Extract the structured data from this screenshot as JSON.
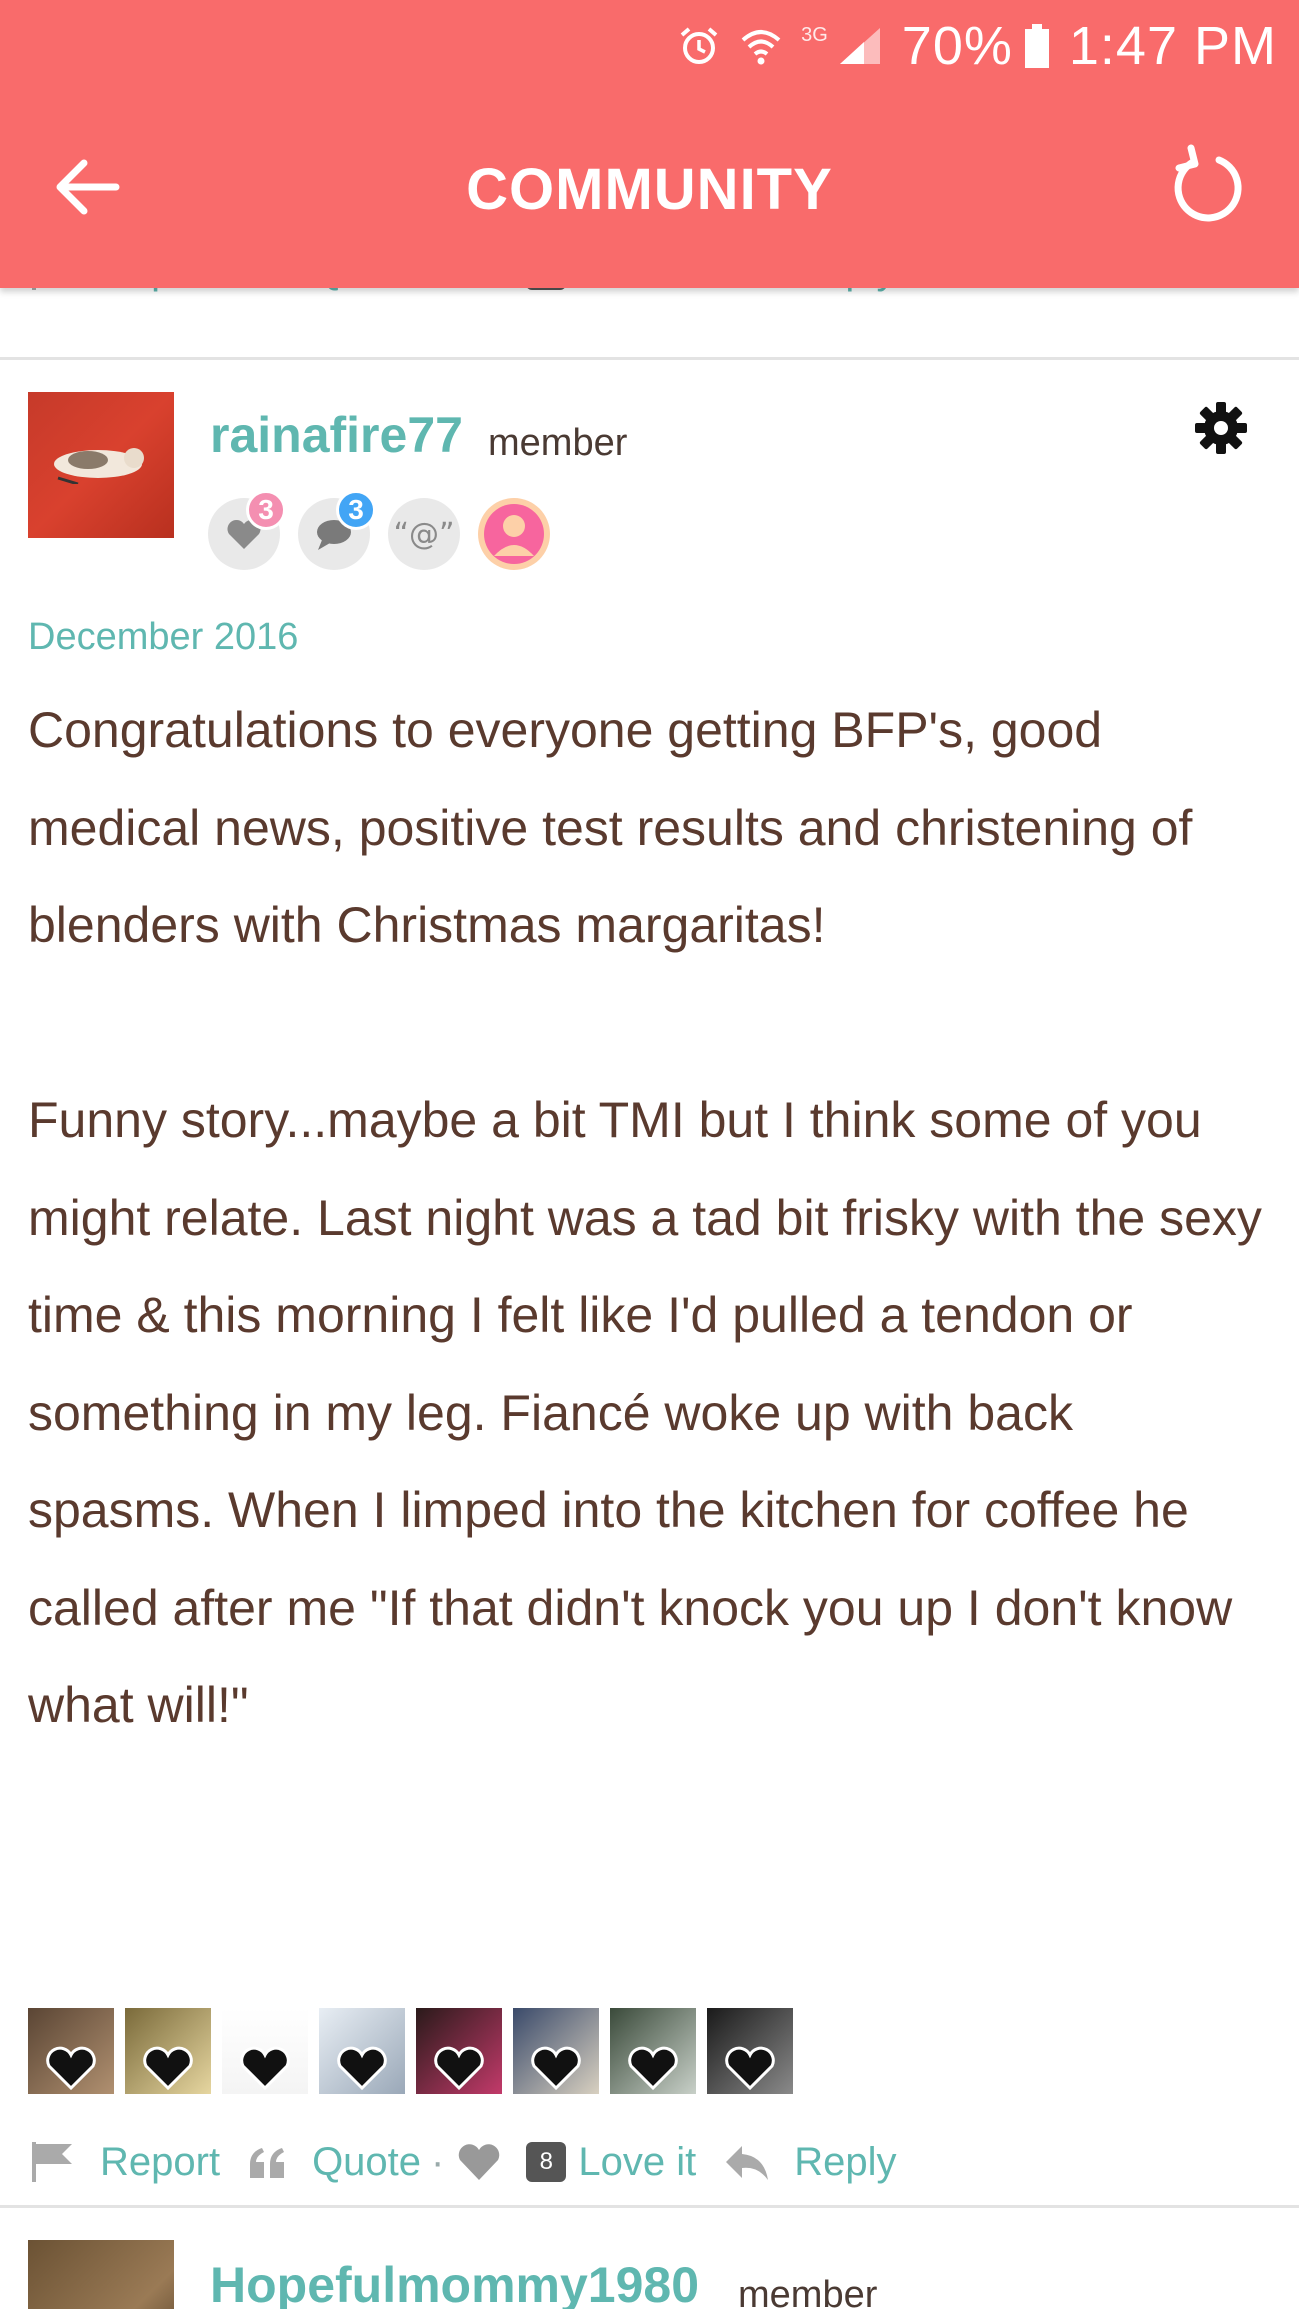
{
  "status_bar": {
    "network": "3G",
    "battery": "70%",
    "time": "1:47 PM"
  },
  "header": {
    "title": "COMMUNITY"
  },
  "actions": {
    "report": "Report",
    "quote": "Quote",
    "separator": "·",
    "love": "Love it",
    "reply": "Reply"
  },
  "post": {
    "username": "rainafire77",
    "role": "member",
    "badges": [
      {
        "icon": "heart-icon",
        "count": "3",
        "count_color": "#f48fb1"
      },
      {
        "icon": "comment-icon",
        "count": "3",
        "count_color": "#42a5f5"
      },
      {
        "icon": "mention-icon",
        "label": "“@”"
      },
      {
        "icon": "profile-icon"
      }
    ],
    "date": "December 2016",
    "body": [
      "Congratulations to everyone getting BFP's, good medical news, positive test results and christening of blenders with Christmas margaritas!",
      "Funny story...maybe a bit TMI but I think some of you might relate. Last night was a tad bit frisky with the sexy time & this morning I felt like I'd pulled a tendon or something in my leg. Fiancé woke up with back spasms. When I limped into the kitchen for coffee he called after me \"If that didn't knock you up I don't know what will!\""
    ],
    "love_count": "8"
  },
  "next_post": {
    "username": "Hopefulmommy1980",
    "role": "member"
  },
  "colors": {
    "header_bg": "#f96b6b",
    "accent": "#5fb7b0",
    "text": "#5a3a2e"
  }
}
